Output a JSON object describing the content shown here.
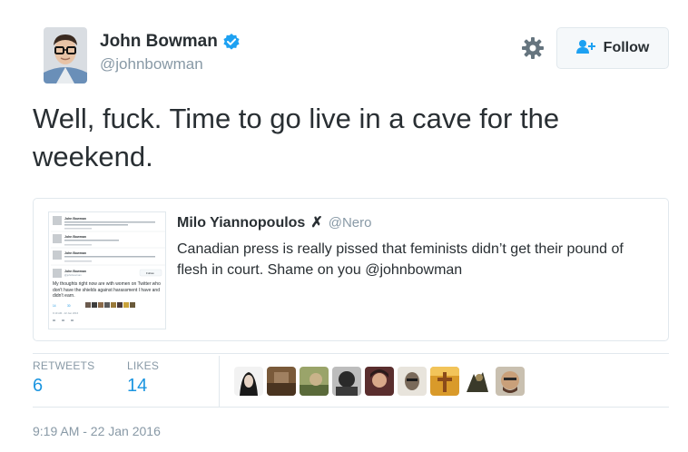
{
  "author": {
    "name": "John Bowman",
    "handle": "@johnbowman",
    "verified_icon": "verified-badge-icon",
    "avatar_icon": "user-avatar"
  },
  "actions": {
    "settings_icon": "gear-icon",
    "follow_icon": "follow-person-plus-icon",
    "follow_label": "Follow"
  },
  "tweet": {
    "text": "Well, fuck. Time to go live in a cave for the weekend."
  },
  "quoted_tweet": {
    "author_name": "Milo Yiannopoulos",
    "author_mark": "✗",
    "author_handle": "@Nero",
    "text": "Canadian press is really pissed that feminists didn’t get their pound of flesh in court. Shame on you @johnbowman",
    "thumbnail": {
      "replies": [
        {
          "name": "John Bowman",
          "handle": "@johnbowman",
          "time": "18m"
        },
        {
          "name": "John Bowman",
          "handle": "@johnbowman",
          "time": "10m"
        },
        {
          "name": "John Bowman",
          "handle": "@johnbowman",
          "time": "10m"
        }
      ],
      "main_name": "John Bowman",
      "main_handle": "@johnbowman",
      "main_text": "My thoughts right now are with women on Twitter who don't have the shields against harassment I have and didn't earn.",
      "retweets": "14",
      "likes": "30",
      "follow_label": "Follow",
      "date": "9:19 AM - 22 Jan 2016"
    }
  },
  "stats": {
    "retweets_label": "RETWEETS",
    "retweets_value": "6",
    "likes_label": "LIKES",
    "likes_value": "14"
  },
  "liked_by": [
    "face-1",
    "face-2",
    "face-3",
    "face-4",
    "face-5",
    "face-6",
    "face-7",
    "face-8",
    "face-9"
  ],
  "timestamp": "9:19 AM - 22 Jan 2016",
  "colors": {
    "link_blue": "#1b95e0",
    "text": "#292f33",
    "muted": "#8899a6",
    "border": "#e1e8ed"
  }
}
